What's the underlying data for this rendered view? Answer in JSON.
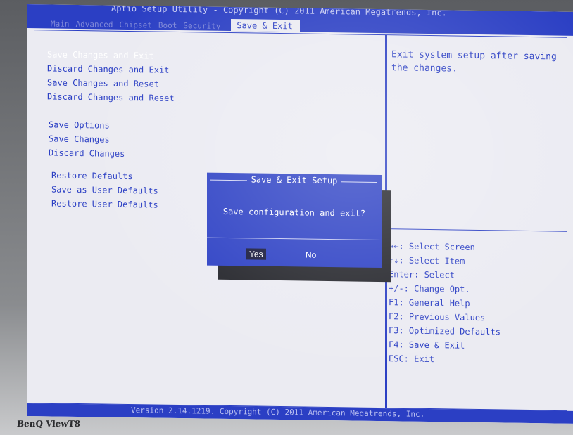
{
  "header": {
    "title": "Aptio Setup Utility - Copyright (C) 2011 American Megatrends, Inc.",
    "tabs": [
      "Main",
      "Advanced",
      "Chipset",
      "Boot",
      "Security",
      "Save & Exit"
    ],
    "active_tab": "Save & Exit"
  },
  "menu": {
    "group1": [
      "Save Changes and Exit",
      "Discard Changes and Exit",
      "Save Changes and Reset",
      "Discard Changes and Reset"
    ],
    "group2": [
      "Save Options",
      "Save Changes",
      "Discard Changes"
    ],
    "group3": [
      "Restore Defaults",
      "Save as User Defaults",
      "Restore User Defaults"
    ],
    "selected": "Save Changes and Exit"
  },
  "help": {
    "description": "Exit system setup after saving the changes.",
    "keys": [
      "→←: Select Screen",
      "↑↓: Select Item",
      "Enter: Select",
      "+/-: Change Opt.",
      "F1: General Help",
      "F2: Previous Values",
      "F3: Optimized Defaults",
      "F4: Save & Exit",
      "ESC: Exit"
    ]
  },
  "dialog": {
    "title": "Save & Exit Setup",
    "message": "Save configuration and exit?",
    "yes_label": "Yes",
    "no_label": "No",
    "selected": "Yes"
  },
  "footer": {
    "text": "Version 2.14.1219. Copyright (C) 2011 American Megatrends, Inc."
  },
  "monitor": {
    "brand": "BenQ ViewT8"
  },
  "colors": {
    "bios_blue": "#2b3fc4",
    "screen_bg": "#ebebf2",
    "dialog_text": "#ffffff",
    "button_selected_bg": "#15173a"
  }
}
